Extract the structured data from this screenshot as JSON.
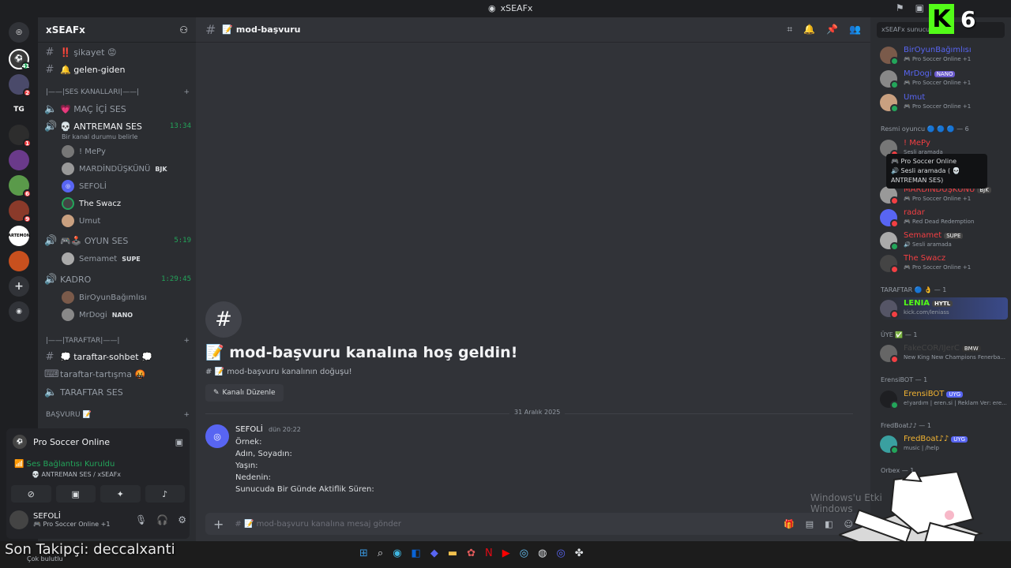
{
  "titlebar": {
    "title": "xSEAFx"
  },
  "servers": {
    "badges": [
      "41",
      "2",
      "1",
      "6",
      "9"
    ],
    "labels": [
      "TG",
      "ARTEMON"
    ]
  },
  "sidebar": {
    "server_name": "xSEAFx",
    "channels_top": [
      {
        "name": "‼️ şikayet 😡"
      },
      {
        "name": "🔔 gelen-giden"
      }
    ],
    "voice_category": "|——|SES KANALLARI|——|",
    "voice_channels": {
      "mac_ici": "💗 MAÇ İÇİ SES",
      "antreman": "💀 ANTREMAN SES",
      "antreman_time": "13:34",
      "antreman_status": "Bir kanal durumu belirle",
      "antreman_users": [
        "! MePy",
        "MARDİNDÜŞKÜNÜ",
        "SEFOLİ",
        "The Swacz",
        "Umut"
      ],
      "antreman_tag": "BJK",
      "oyun": "🎮🕹️ OYUN SES",
      "oyun_time": "5:19",
      "oyun_users": [
        "Semamet"
      ],
      "oyun_tag": "SUPE",
      "kadro": "KADRO",
      "kadro_time": "1:29:45",
      "kadro_users": [
        "BirOyunBağımlısı",
        "MrDogi"
      ],
      "kadro_tag": "NANO"
    },
    "taraftar_category": "|——|TARAFTAR|——|",
    "taraftar_channels": [
      "💭 taraftar-sohbet 💭",
      "taraftar-tartışma 🤬",
      "TARAFTAR SES"
    ],
    "basvuru_category": "BAŞVURU 📝"
  },
  "panel": {
    "activity": "Pro Soccer Online",
    "connection": "Ses Bağlantısı Kuruldu",
    "connection_channel": "💀 ANTREMAN SES / xSEAFx",
    "username": "SEFOLİ",
    "user_status": "🎮 Pro Soccer Online +1"
  },
  "main": {
    "channel_name": "📝 mod-başvuru",
    "welcome_title": "📝 mod-başvuru kanalına hoş geldin!",
    "welcome_sub": "# 📝 mod-başvuru kanalının doğuşu!",
    "edit_label": "Kanalı Düzenle",
    "date_divider": "31 Aralık 2025",
    "message": {
      "author": "SEFOLİ",
      "timestamp": "dün 20:22",
      "lines": [
        "Örnek:",
        "Adın, Soyadın:",
        "Yaşın:",
        "Nedenin:",
        "Sunucuda Bir Günde Aktiflik Süren:"
      ]
    },
    "composer_placeholder": "# 📝 mod-başvuru kanalına mesaj gönder"
  },
  "members": {
    "search_placeholder": "xSEAFx sunucusu",
    "top": [
      {
        "name": "BirOyunBağımlısı",
        "activity": "🎮 Pro Soccer Online +1",
        "tag": ""
      },
      {
        "name": "MrDogi",
        "activity": "🎮 Pro Soccer Online +1",
        "tag": "NANO"
      },
      {
        "name": "Umut",
        "activity": "🎮 Pro Soccer Online +1",
        "tag": ""
      }
    ],
    "group_resmi": "Resmi oyuncu 🔵 🔵 🔵 — 6",
    "resmi": [
      {
        "name": "! MePy",
        "activity": "Sesli aramada",
        "tag": ""
      },
      {
        "name": "MARDİNDÜŞKÜNÜ",
        "activity": "🎮 Pro Soccer Online +1",
        "tag": "BJK"
      },
      {
        "name": "radar",
        "activity": "🎮 Red Dead Redemption",
        "tag": ""
      },
      {
        "name": "Semamet",
        "activity": "🔊 Sesli aramada",
        "tag": "SUPE"
      },
      {
        "name": "The Swacz",
        "activity": "🎮 Pro Soccer Online +1",
        "tag": ""
      }
    ],
    "popup": [
      "🎮 Pro Soccer Online",
      "🔊 Sesli aramada ( 💀 ANTREMAN SES)"
    ],
    "group_taraftar": "TARAFTAR 🔵 👌 — 1",
    "taraftar": [
      {
        "name": "LENIA",
        "activity": "kick.com/leniass",
        "tag": "HYTL"
      }
    ],
    "group_uye": "ÜYE ✅ — 1",
    "uye": [
      {
        "name": "FakeCOR/IJerC",
        "activity": "New King New Champions Fenerba...",
        "tag": "BMW"
      }
    ],
    "group_erensi": "ErensiBOT — 1",
    "erensi": [
      {
        "name": "ErensiBOT",
        "activity": "e!yardım | eren.si | Reklam Ver: ere...",
        "tag": "UYG"
      }
    ],
    "group_fred": "FredBoat♪♪ — 1",
    "fred": [
      {
        "name": "FredBoat♪♪",
        "activity": "music | /help",
        "tag": "UYG"
      }
    ],
    "group_last": "Orbex — 1"
  },
  "overlay": {
    "follower": "Son Takipçi: deccalxanti",
    "watermark1": "Windows'u Etki",
    "watermark2": "Windows",
    "weather": "Çok bulutlu",
    "kick_number": "6",
    "kick_letter": "K"
  },
  "colors": {
    "accent": "#5865f2",
    "online": "#23a55a",
    "dnd": "#f23f43",
    "kick": "#53fc18"
  }
}
